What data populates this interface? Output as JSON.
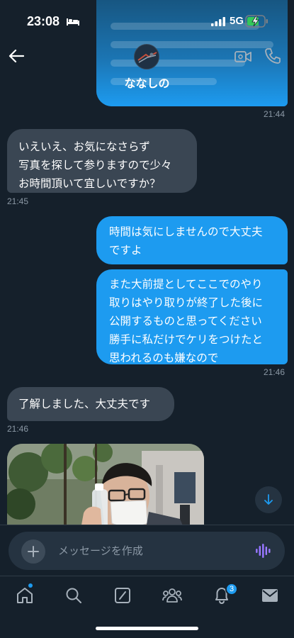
{
  "status_bar": {
    "time": "23:08",
    "network": "5G"
  },
  "header": {
    "contact_name": "ななしの"
  },
  "messages": [
    {
      "id": "m0",
      "direction": "out",
      "text": "",
      "timestamp": "21:44"
    },
    {
      "id": "m1",
      "direction": "in",
      "text": "いえいえ、お気になさらず\n写真を探して参りますので少々\nお時間頂いて宜しいですか？",
      "timestamp": "21:45"
    },
    {
      "id": "m2",
      "direction": "out",
      "text": "時間は気にしませんので大丈夫\nですよ",
      "timestamp": ""
    },
    {
      "id": "m3",
      "direction": "out",
      "text": "また大前提としてここでのやり\n取りはやり取りが終了した後に\n公開するものと思ってください\n勝手に私だけでケリをつけたと\n思われるのも嫌なので",
      "timestamp": "21:46"
    },
    {
      "id": "m4",
      "direction": "in",
      "text": "了解しました、大丈夫です",
      "timestamp": "21:46"
    },
    {
      "id": "m5",
      "direction": "in",
      "type": "photo",
      "text": "",
      "timestamp": ""
    }
  ],
  "composer": {
    "placeholder": "メッセージを作成"
  },
  "tab_bar": {
    "items": [
      "home-icon",
      "search-icon",
      "grok-icon",
      "communities-icon",
      "notifications-icon",
      "messages-icon"
    ],
    "notification_count": "3"
  },
  "colors": {
    "background": "#15202b",
    "outgoing_bubble": "#1d9bf0",
    "incoming_bubble": "#3a4653",
    "timestamp": "#8b98a5",
    "accent": "#1d9bf0"
  }
}
